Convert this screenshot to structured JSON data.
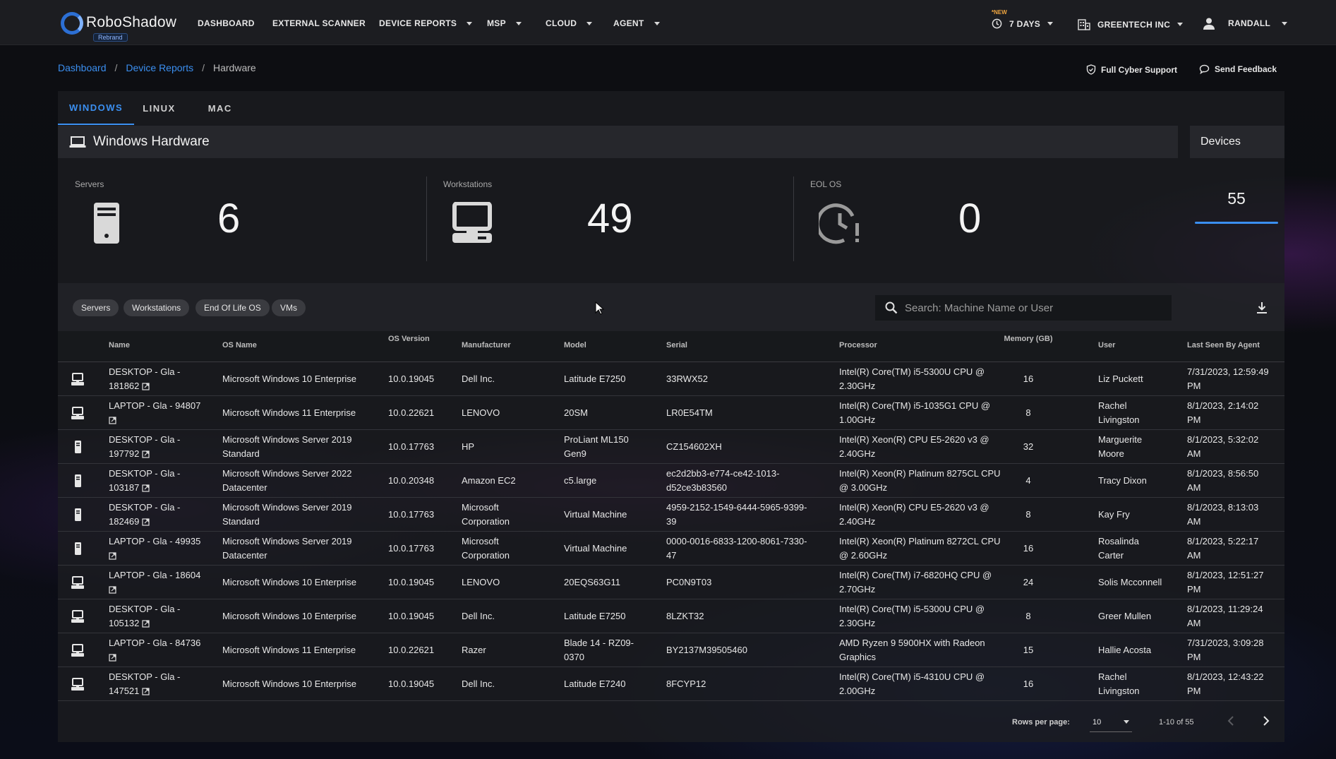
{
  "app": {
    "name": "RoboShadow",
    "badge": "Rebrand"
  },
  "nav": {
    "items": [
      {
        "label": "DASHBOARD",
        "has_menu": false
      },
      {
        "label": "EXTERNAL SCANNER",
        "has_menu": false
      },
      {
        "label": "DEVICE REPORTS",
        "has_menu": true
      },
      {
        "label": "MSP",
        "has_menu": true
      },
      {
        "label": "CLOUD",
        "has_menu": true
      },
      {
        "label": "AGENT",
        "has_menu": true
      }
    ],
    "new_tag": "*NEW",
    "time_range": "7 DAYS",
    "org": "GREENTECH INC",
    "user": "RANDALL"
  },
  "breadcrumb": [
    "Dashboard",
    "Device Reports",
    "Hardware"
  ],
  "actions": {
    "support": "Full Cyber Support",
    "feedback": "Send Feedback"
  },
  "tabs": [
    {
      "label": "WINDOWS",
      "active": true
    },
    {
      "label": "LINUX",
      "active": false
    },
    {
      "label": "MAC",
      "active": false
    }
  ],
  "section_title": "Windows Hardware",
  "devices": {
    "title": "Devices",
    "count": "55"
  },
  "stats": [
    {
      "label": "Servers",
      "value": "6",
      "icon": "server-icon"
    },
    {
      "label": "Workstations",
      "value": "49",
      "icon": "workstation-icon"
    },
    {
      "label": "EOL OS",
      "value": "0",
      "icon": "clock-alert-icon"
    }
  ],
  "filters": [
    "Servers",
    "Workstations",
    "End Of Life OS",
    "VMs"
  ],
  "search": {
    "placeholder": "Search: Machine Name or User"
  },
  "table": {
    "columns": [
      "Name",
      "OS Name",
      "OS Version",
      "Manufacturer",
      "Model",
      "Serial",
      "Processor",
      "Memory (GB)",
      "User",
      "Last Seen By Agent"
    ],
    "rows": [
      {
        "type": "workstation",
        "name": [
          "DESKTOP - Gla -",
          "181862"
        ],
        "os": [
          "Microsoft Windows 10 Enterprise"
        ],
        "version": "10.0.19045",
        "manufacturer": [
          "Dell Inc."
        ],
        "model": [
          "Latitude E7250"
        ],
        "serial": [
          "33RWX52"
        ],
        "processor": [
          "Intel(R) Core(TM) i5-5300U CPU @",
          "2.30GHz"
        ],
        "memory": "16",
        "user": [
          "Liz Puckett"
        ],
        "last_seen": [
          "7/31/2023, 12:59:49",
          "PM"
        ]
      },
      {
        "type": "workstation",
        "name": [
          "LAPTOP - Gla - 94807",
          ""
        ],
        "os": [
          "Microsoft Windows 11 Enterprise"
        ],
        "version": "10.0.22621",
        "manufacturer": [
          "LENOVO"
        ],
        "model": [
          "20SM"
        ],
        "serial": [
          "LR0E54TM"
        ],
        "processor": [
          "Intel(R) Core(TM) i5-1035G1 CPU @",
          "1.00GHz"
        ],
        "memory": "8",
        "user": [
          "Rachel",
          "Livingston"
        ],
        "last_seen": [
          "8/1/2023, 2:14:02",
          "PM"
        ]
      },
      {
        "type": "server",
        "name": [
          "DESKTOP - Gla -",
          "197792"
        ],
        "os": [
          "Microsoft Windows Server 2019",
          "Standard"
        ],
        "version": "10.0.17763",
        "manufacturer": [
          "HP"
        ],
        "model": [
          "ProLiant ML150",
          "Gen9"
        ],
        "serial": [
          "CZ154602XH"
        ],
        "processor": [
          "Intel(R) Xeon(R) CPU E5-2620 v3 @",
          "2.40GHz"
        ],
        "memory": "32",
        "user": [
          "Marguerite",
          "Moore"
        ],
        "last_seen": [
          "8/1/2023, 5:32:02",
          "AM"
        ]
      },
      {
        "type": "server",
        "name": [
          "DESKTOP - Gla -",
          "103187"
        ],
        "os": [
          "Microsoft Windows Server 2022",
          "Datacenter"
        ],
        "version": "10.0.20348",
        "manufacturer": [
          "Amazon EC2"
        ],
        "model": [
          "c5.large"
        ],
        "serial": [
          "ec2d2bb3-e774-ce42-1013-",
          "d52ce3b83560"
        ],
        "processor": [
          "Intel(R) Xeon(R) Platinum 8275CL CPU",
          "@ 3.00GHz"
        ],
        "memory": "4",
        "user": [
          "Tracy Dixon"
        ],
        "last_seen": [
          "8/1/2023, 8:56:50",
          "AM"
        ]
      },
      {
        "type": "server",
        "name": [
          "DESKTOP - Gla -",
          "182469"
        ],
        "os": [
          "Microsoft Windows Server 2019",
          "Standard"
        ],
        "version": "10.0.17763",
        "manufacturer": [
          "Microsoft",
          "Corporation"
        ],
        "model": [
          "Virtual Machine"
        ],
        "serial": [
          "4959-2152-1549-6444-5965-9399-",
          "39"
        ],
        "processor": [
          "Intel(R) Xeon(R) CPU E5-2620 v3 @",
          "2.40GHz"
        ],
        "memory": "8",
        "user": [
          "Kay Fry"
        ],
        "last_seen": [
          "8/1/2023, 8:13:03",
          "AM"
        ]
      },
      {
        "type": "server",
        "name": [
          "LAPTOP - Gla - 49935",
          ""
        ],
        "os": [
          "Microsoft Windows Server 2019",
          "Datacenter"
        ],
        "version": "10.0.17763",
        "manufacturer": [
          "Microsoft",
          "Corporation"
        ],
        "model": [
          "Virtual Machine"
        ],
        "serial": [
          "0000-0016-6833-1200-8061-7330-",
          "47"
        ],
        "processor": [
          "Intel(R) Xeon(R) Platinum 8272CL CPU",
          "@ 2.60GHz"
        ],
        "memory": "16",
        "user": [
          "Rosalinda",
          "Carter"
        ],
        "last_seen": [
          "8/1/2023, 5:22:17",
          "AM"
        ]
      },
      {
        "type": "workstation",
        "name": [
          "LAPTOP - Gla - 18604",
          ""
        ],
        "os": [
          "Microsoft Windows 10 Enterprise"
        ],
        "version": "10.0.19045",
        "manufacturer": [
          "LENOVO"
        ],
        "model": [
          "20EQS63G11"
        ],
        "serial": [
          "PC0N9T03"
        ],
        "processor": [
          "Intel(R) Core(TM) i7-6820HQ CPU @",
          "2.70GHz"
        ],
        "memory": "24",
        "user": [
          "Solis Mcconnell"
        ],
        "last_seen": [
          "8/1/2023, 12:51:27",
          "PM"
        ]
      },
      {
        "type": "workstation",
        "name": [
          "DESKTOP - Gla -",
          "105132"
        ],
        "os": [
          "Microsoft Windows 10 Enterprise"
        ],
        "version": "10.0.19045",
        "manufacturer": [
          "Dell Inc."
        ],
        "model": [
          "Latitude E7250"
        ],
        "serial": [
          "8LZKT32"
        ],
        "processor": [
          "Intel(R) Core(TM) i5-5300U CPU @",
          "2.30GHz"
        ],
        "memory": "8",
        "user": [
          "Greer Mullen"
        ],
        "last_seen": [
          "8/1/2023, 11:29:24",
          "AM"
        ]
      },
      {
        "type": "workstation",
        "name": [
          "LAPTOP - Gla - 84736",
          ""
        ],
        "os": [
          "Microsoft Windows 11 Enterprise"
        ],
        "version": "10.0.22621",
        "manufacturer": [
          "Razer"
        ],
        "model": [
          "Blade 14 - RZ09-",
          "0370"
        ],
        "serial": [
          "BY2137M39505460"
        ],
        "processor": [
          "AMD Ryzen 9 5900HX with Radeon",
          "Graphics"
        ],
        "memory": "15",
        "user": [
          "Hallie Acosta"
        ],
        "last_seen": [
          "7/31/2023, 3:09:28",
          "PM"
        ]
      },
      {
        "type": "workstation",
        "name": [
          "DESKTOP - Gla -",
          "147521"
        ],
        "os": [
          "Microsoft Windows 10 Enterprise"
        ],
        "version": "10.0.19045",
        "manufacturer": [
          "Dell Inc."
        ],
        "model": [
          "Latitude E7240"
        ],
        "serial": [
          "8FCYP12"
        ],
        "processor": [
          "Intel(R) Core(TM) i5-4310U CPU @",
          "2.00GHz"
        ],
        "memory": "16",
        "user": [
          "Rachel",
          "Livingston"
        ],
        "last_seen": [
          "8/1/2023, 12:43:22",
          "PM"
        ]
      }
    ]
  },
  "pagination": {
    "rows_per_page_label": "Rows per page:",
    "rows_per_page": "10",
    "range": "1-10 of 55"
  },
  "colors": {
    "accent": "#3b8ff0",
    "nav_bg": "#1c1d21",
    "panel_bg": "#1c1d21",
    "new_tag": "#f0a640"
  }
}
